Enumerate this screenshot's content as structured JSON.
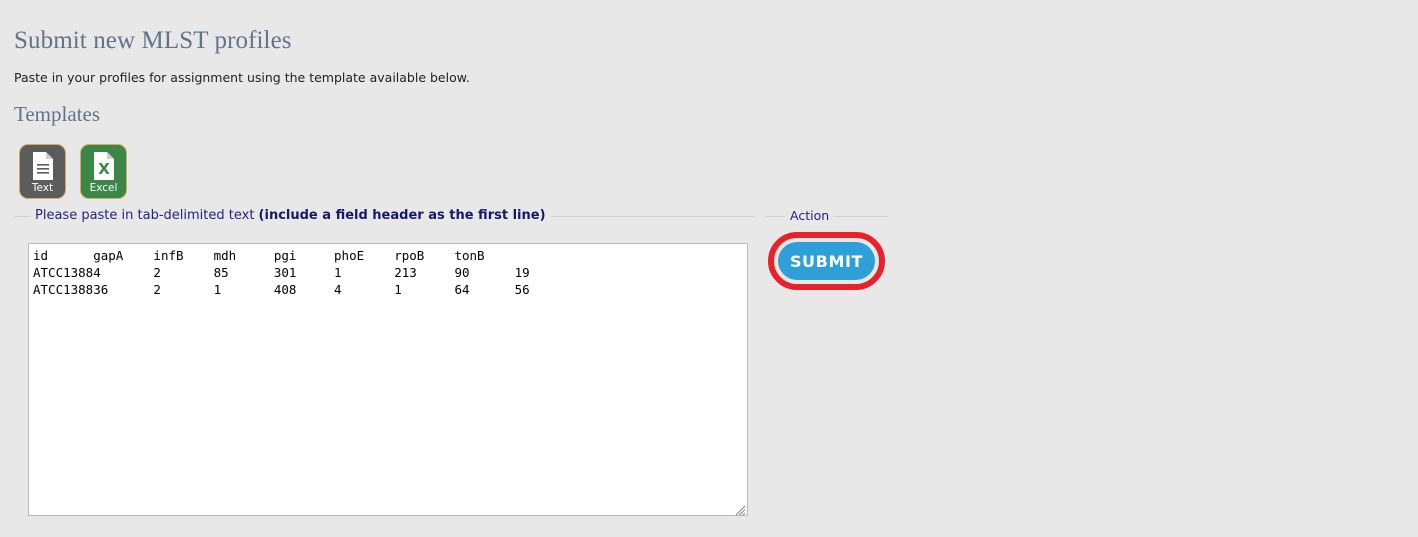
{
  "page": {
    "title": "Submit new MLST profiles",
    "intro": "Paste in your profiles for assignment using the template available below.",
    "templates_heading": "Templates",
    "background_color": "#e8e8e8",
    "heading_color": "#61748a"
  },
  "templates": [
    {
      "label": "Text",
      "icon": "text-file-icon",
      "color": "#5c5c5c"
    },
    {
      "label": "Excel",
      "icon": "excel-file-icon",
      "color": "#3c8745"
    }
  ],
  "paste_fieldset": {
    "legend_normal": "Please paste in tab-delimited text ",
    "legend_bold": "(include a field header as the first line)",
    "legend_color": "#242482"
  },
  "action_fieldset": {
    "legend": "Action",
    "submit_label": "SUBMIT",
    "submit_color": "#2f9fd8",
    "highlight_color": "#e8222a"
  },
  "paste_input": {
    "placeholder": "",
    "value": "id\tgapA\tinfB\tmdh\tpgi\tphoE\trpoB\ttonB\nATCC13884\t2\t85\t301\t1\t213\t90\t19\nATCC138836\t2\t1\t408\t4\t1\t64\t56",
    "columns": [
      "id",
      "gapA",
      "infB",
      "mdh",
      "pgi",
      "phoE",
      "rpoB",
      "tonB"
    ],
    "rows": [
      [
        "ATCC13884",
        "2",
        "85",
        "301",
        "1",
        "213",
        "90",
        "19"
      ],
      [
        "ATCC138836",
        "2",
        "1",
        "408",
        "4",
        "1",
        "64",
        "56"
      ]
    ]
  }
}
